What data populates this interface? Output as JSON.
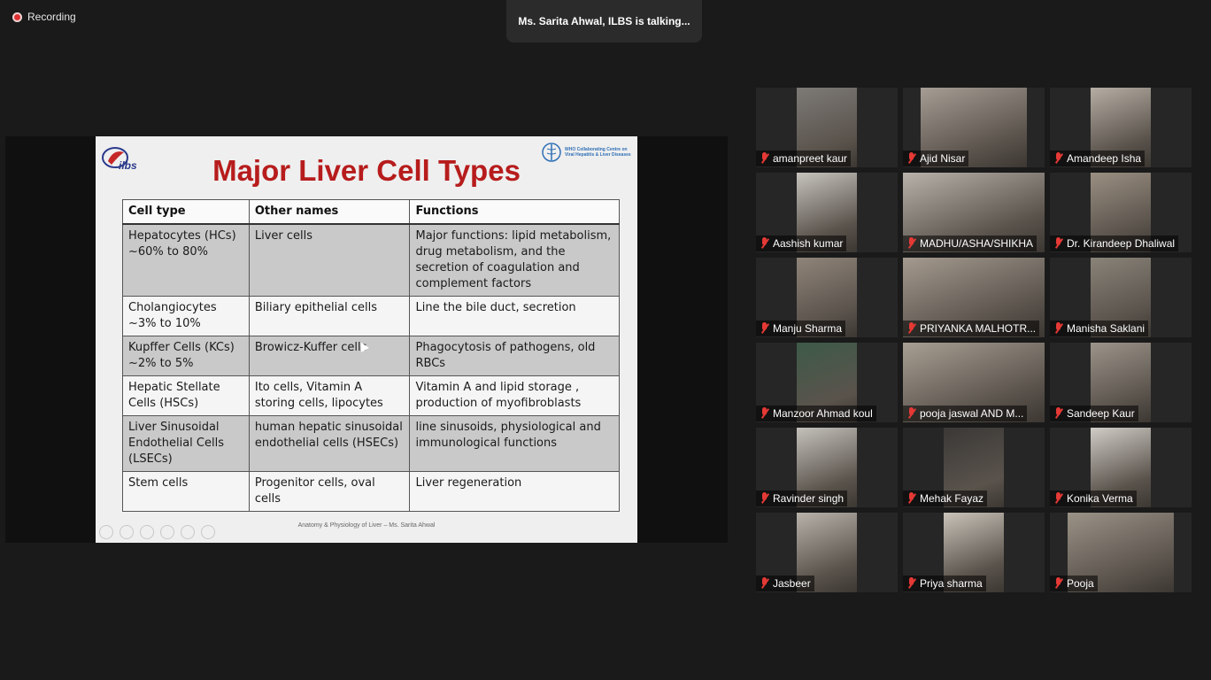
{
  "recording": {
    "label": "Recording"
  },
  "banner": {
    "text": "Ms. Sarita Ahwal, ILBS is talking..."
  },
  "slide": {
    "logo_left": "ilbs",
    "logo_right": "WHO Collaborating Centre on Viral Hepatitis & Liver Diseases",
    "title": "Major Liver Cell Types",
    "headers": [
      "Cell type",
      "Other names",
      "Functions"
    ],
    "rows": [
      {
        "cell": "Hepatocytes (HCs)\n~60% to 80%",
        "other": "Liver cells",
        "func": "Major functions: lipid metabolism, drug metabolism, and the secretion of coagulation and complement factors"
      },
      {
        "cell": "Cholangiocytes\n~3% to 10%",
        "other": "Biliary epithelial cells",
        "func": "Line the bile duct, secretion"
      },
      {
        "cell": "Kupffer Cells (KCs)\n~2% to 5%",
        "other": "Browicz-Kuffer cells",
        "func": "Phagocytosis of pathogens, old RBCs"
      },
      {
        "cell": "Hepatic Stellate Cells (HSCs)",
        "other": "Ito cells, Vitamin A storing cells, lipocytes",
        "func": "Vitamin A and lipid storage , production of myofibroblasts"
      },
      {
        "cell": "Liver Sinusoidal Endothelial Cells (LSECs)",
        "other": "human hepatic sinusoidal endothelial cells (HSECs)",
        "func": " line sinusoids, physiological and immunological functions"
      },
      {
        "cell": "Stem cells",
        "other": "Progenitor cells, oval cells",
        "func": "Liver regeneration"
      }
    ],
    "footer": "Anatomy & Physiology of Liver – Ms. Sarita Ahwal"
  },
  "participants": [
    {
      "name": "amanpreet kaur",
      "muted": true,
      "tone": "#7d7a76"
    },
    {
      "name": "Ajid Nisar",
      "muted": true,
      "tone": "#a69d94"
    },
    {
      "name": "Amandeep Isha",
      "muted": true,
      "tone": "#b6aea4"
    },
    {
      "name": "Aashish kumar",
      "muted": true,
      "tone": "#c6c3bd"
    },
    {
      "name": "MADHU/ASHA/SHIKHA",
      "muted": true,
      "tone": "#b9b2ab"
    },
    {
      "name": "Dr. Kirandeep Dhaliwal",
      "muted": true,
      "tone": "#9a8f82"
    },
    {
      "name": "Manju Sharma",
      "muted": true,
      "tone": "#8f8479"
    },
    {
      "name": "PRIYANKA MALHOTR...",
      "muted": true,
      "tone": "#a49a8f"
    },
    {
      "name": "Manisha Saklani",
      "muted": true,
      "tone": "#8a8379"
    },
    {
      "name": "Manzoor Ahmad koul",
      "muted": true,
      "tone": "#3d5a48"
    },
    {
      "name": "pooja jaswal AND M...",
      "muted": true,
      "tone": "#a89f93"
    },
    {
      "name": "Sandeep Kaur",
      "muted": true,
      "tone": "#9c948a"
    },
    {
      "name": "Ravinder singh",
      "muted": true,
      "tone": "#c4c1bb"
    },
    {
      "name": "Mehak Fayaz",
      "muted": true,
      "tone": "#3a3836"
    },
    {
      "name": "Konika Verma",
      "muted": true,
      "tone": "#d0ccc6"
    },
    {
      "name": "Jasbeer",
      "muted": true,
      "tone": "#b8b2ab"
    },
    {
      "name": "Priya sharma",
      "muted": true,
      "tone": "#c9c3b9"
    },
    {
      "name": "Pooja",
      "muted": true,
      "tone": "#9b9287"
    }
  ]
}
